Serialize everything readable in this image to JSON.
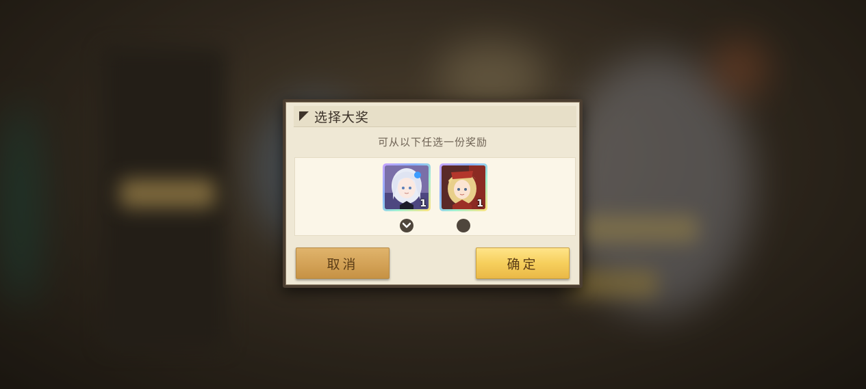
{
  "dialog": {
    "title": "选择大奖",
    "subtitle": "可从以下任选一份奖励",
    "rewards": [
      {
        "name": "silver-haired-character-card",
        "count": "1",
        "selected": true
      },
      {
        "name": "blonde-character-card",
        "count": "1",
        "selected": false
      }
    ],
    "cancel_label": "取消",
    "confirm_label": "确定"
  },
  "colors": {
    "dialog_bg": "#efe8d5",
    "dialog_border": "#4b3e31",
    "confirm_button": "#f6cf5c",
    "cancel_button": "#d4a358",
    "radio": "#4f463c"
  },
  "icons": [
    "title-corner-icon",
    "check-icon",
    "radio-empty-icon"
  ]
}
